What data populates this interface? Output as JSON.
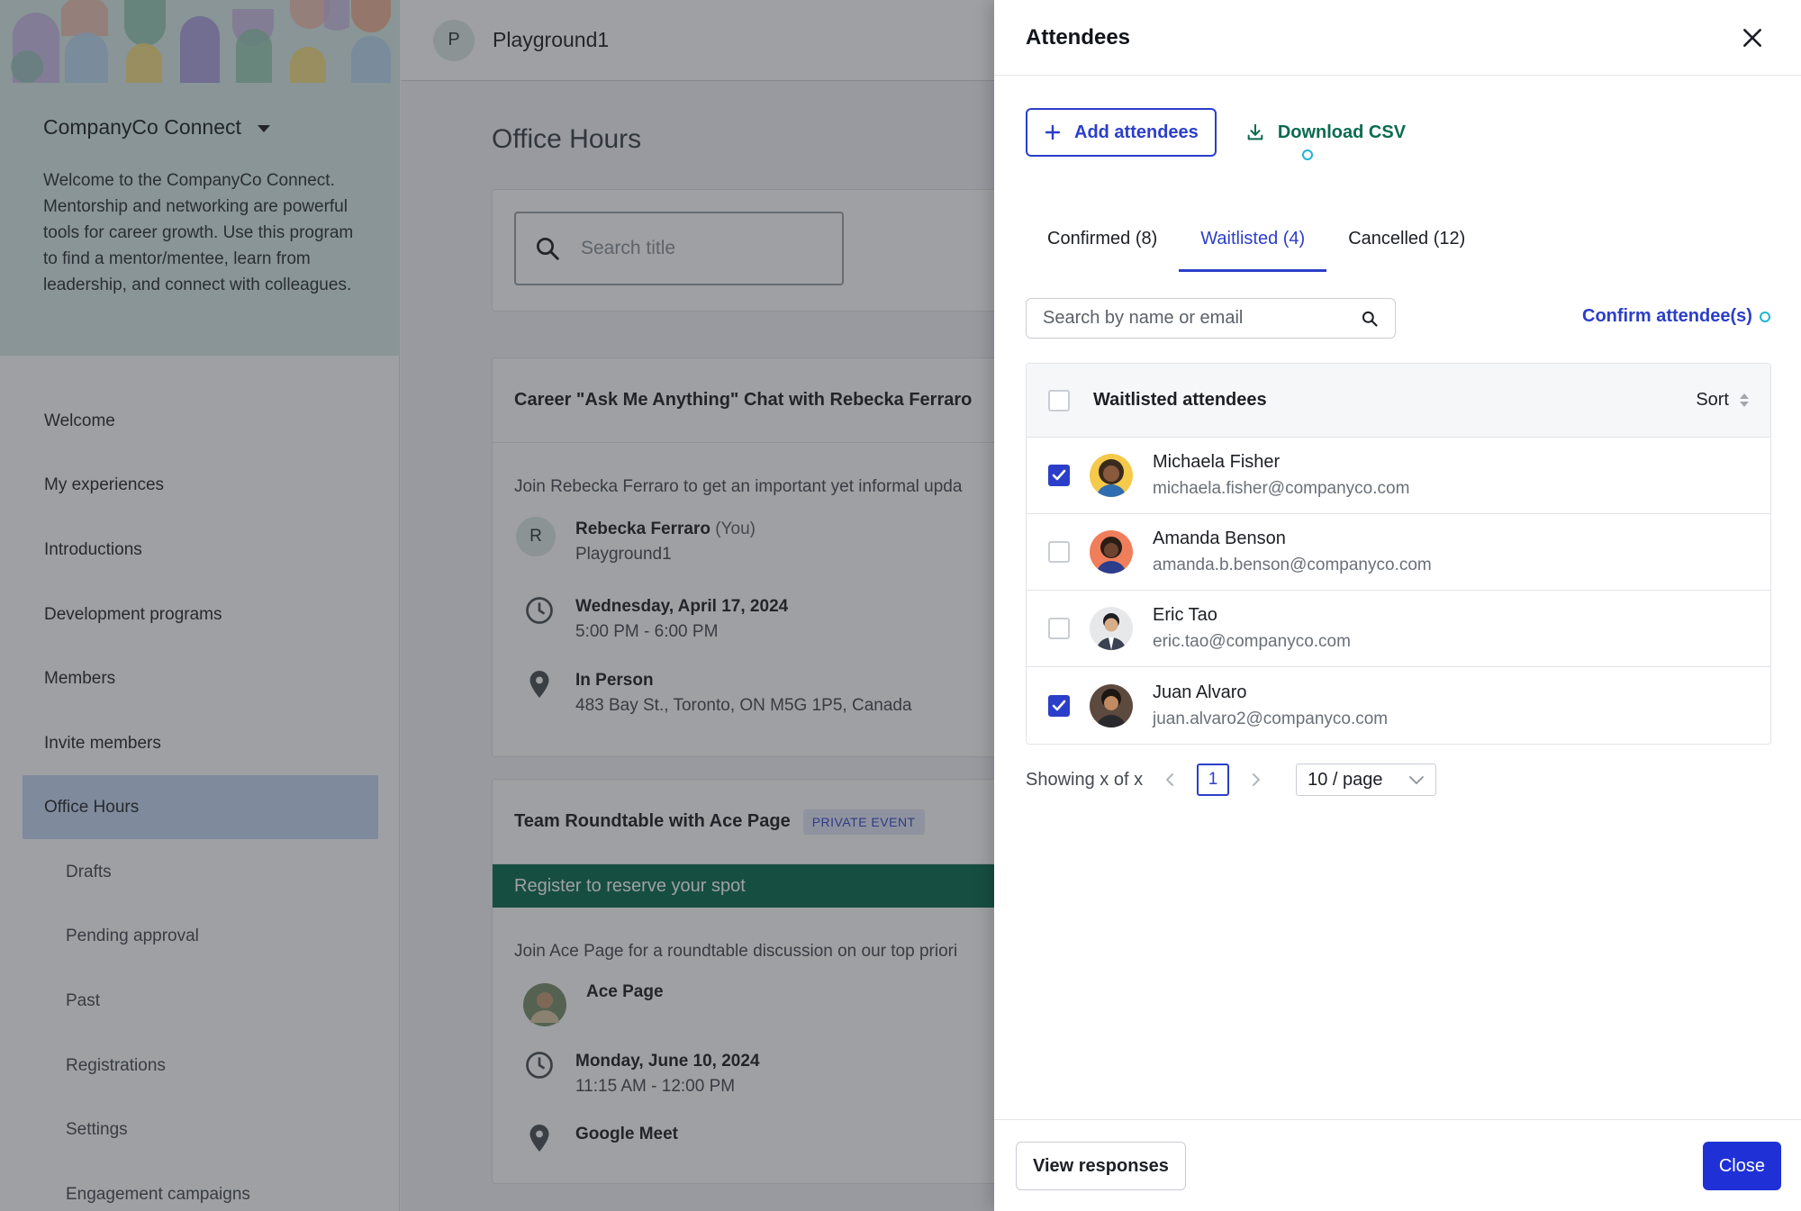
{
  "sidebar": {
    "program_name": "CompanyCo Connect",
    "intro": "Welcome to the CompanyCo Connect. Mentorship and networking are powerful tools for career growth. Use this program to find a mentor/mentee, learn from leadership, and connect with colleagues.",
    "items": [
      {
        "label": "Welcome"
      },
      {
        "label": "My experiences"
      },
      {
        "label": "Introductions"
      },
      {
        "label": "Development programs"
      },
      {
        "label": "Members"
      },
      {
        "label": "Invite members"
      },
      {
        "label": "Office Hours",
        "active": true
      },
      {
        "label": "Drafts"
      },
      {
        "label": "Pending approval"
      },
      {
        "label": "Past"
      },
      {
        "label": "Registrations"
      },
      {
        "label": "Settings"
      },
      {
        "label": "Engagement campaigns"
      }
    ]
  },
  "topbar": {
    "workspace_initial": "P",
    "workspace_name": "Playground1"
  },
  "main": {
    "title": "Office Hours",
    "search_placeholder": "Search title",
    "events": [
      {
        "title": "Career \"Ask Me Anything\" Chat with Rebecka Ferraro",
        "description": "Join Rebecka Ferraro to get an important yet informal upda",
        "host_initial": "R",
        "host_name": "Rebecka Ferraro",
        "host_suffix": "(You)",
        "host_org": "Playground1",
        "date": "Wednesday, April 17, 2024",
        "time": "5:00 PM - 6:00 PM",
        "location_type": "In Person",
        "address": "483 Bay St., Toronto, ON M5G 1P5, Canada"
      },
      {
        "title": "Team Roundtable with Ace Page",
        "badge": "PRIVATE EVENT",
        "register_text": "Register to reserve your spot",
        "description": "Join Ace Page for a roundtable discussion on our top priori",
        "host_name": "Ace Page",
        "date": "Monday, June 10, 2024",
        "time": "11:15 AM - 12:00 PM",
        "location_type": "Google Meet"
      }
    ]
  },
  "drawer": {
    "title": "Attendees",
    "add_label": "Add attendees",
    "download_label": "Download CSV",
    "tabs": [
      {
        "label": "Confirmed (8)"
      },
      {
        "label": "Waitlisted (4)",
        "active": true
      },
      {
        "label": "Cancelled (12)"
      }
    ],
    "search_placeholder": "Search by name or email",
    "confirm_label": "Confirm attendee(s)",
    "table_header": "Waitlisted attendees",
    "sort_label": "Sort",
    "attendees": [
      {
        "name": "Michaela Fisher",
        "email": "michaela.fisher@companyco.com",
        "checked": true
      },
      {
        "name": "Amanda Benson",
        "email": "amanda.b.benson@companyco.com",
        "checked": false
      },
      {
        "name": "Eric Tao",
        "email": "eric.tao@companyco.com",
        "checked": false
      },
      {
        "name": "Juan Alvaro",
        "email": "juan.alvaro2@companyco.com",
        "checked": true
      }
    ],
    "pagination": {
      "summary": "Showing x of x",
      "current_page": "1",
      "page_size": "10 / page"
    },
    "view_responses_label": "View responses",
    "close_label": "Close"
  },
  "colors": {
    "accent": "#2b3ec9",
    "primary_button": "#1f31d6",
    "download_green": "#0a6b4f",
    "sidebar_active": "#c9d8f5",
    "hero_bg": "#d9ece7"
  },
  "icons": {
    "close": "close-icon",
    "add": "plus-icon",
    "download": "download-icon",
    "search": "search-icon",
    "clock": "clock-icon",
    "location": "map-pin-icon",
    "caret": "chevron-down-icon"
  }
}
